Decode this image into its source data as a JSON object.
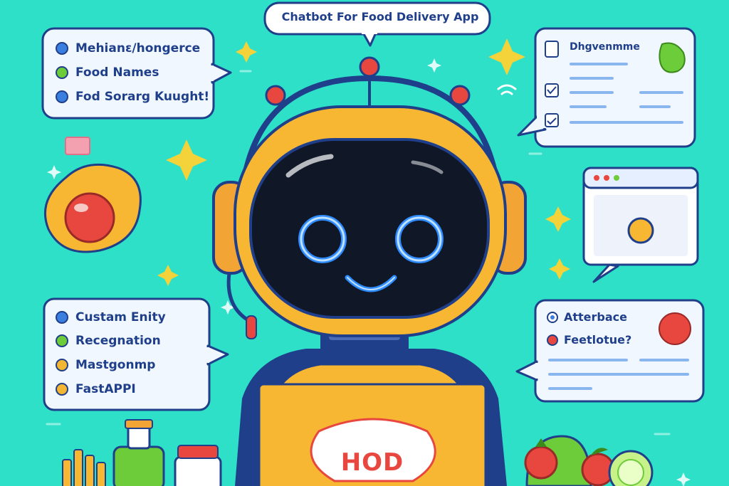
{
  "title": "Chatbot For Food Delivery App",
  "left_top_list": {
    "items": [
      {
        "label": "Mehianɛ/hongerce",
        "dot": "#3a7fe0"
      },
      {
        "label": "Food Names",
        "dot": "#6ccc3a"
      },
      {
        "label": "Fod Sorarg Kuught!",
        "dot": "#3a7fe0"
      }
    ]
  },
  "left_bottom_list": {
    "items": [
      {
        "label": "Custam Enity",
        "dot": "#3a7fe0"
      },
      {
        "label": "Recegnation",
        "dot": "#6ccc3a"
      },
      {
        "label": "Mastgonmp",
        "dot": "#f2b632"
      },
      {
        "label": "FastAPPI",
        "dot": "#f2b632"
      }
    ]
  },
  "right_top_card": {
    "heading": "Dhgvenmme"
  },
  "right_bottom_list": {
    "items": [
      {
        "label": "Atterbace",
        "dot": "#3a7fe0"
      },
      {
        "label": "Feetlotue?",
        "dot": "#e8473f"
      }
    ]
  },
  "robot_chest_logo": "HOD",
  "colors": {
    "background": "#2ee0c8",
    "robot_body": "#f7b733",
    "visor": "#101828",
    "eye_glow": "#2f8cff",
    "ink": "#1f3f8a"
  }
}
